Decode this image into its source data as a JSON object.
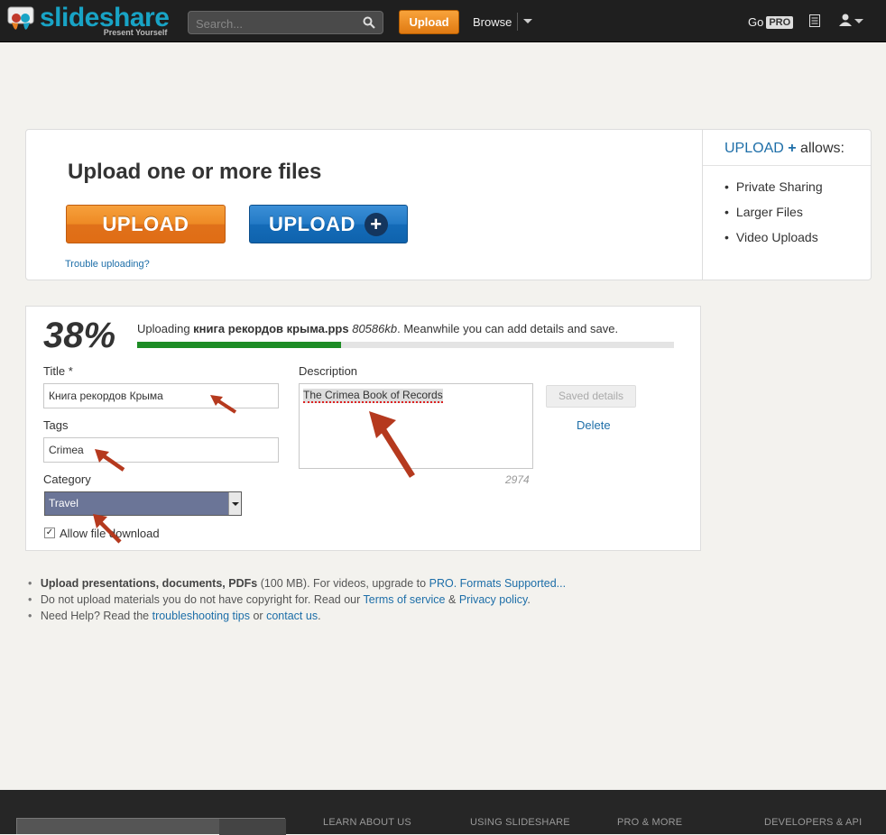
{
  "header": {
    "logo_word": "slideshare",
    "logo_tagline": "Present Yourself",
    "search_placeholder": "Search...",
    "upload_label": "Upload",
    "browse_label": "Browse",
    "go_label": "Go",
    "pro_badge": "PRO"
  },
  "upload_card": {
    "title": "Upload one or more files",
    "upload_button": "UPLOAD",
    "upload_plus_button": "UPLOAD",
    "plus_symbol": "+",
    "trouble_link": "Trouble uploading?",
    "allows_upload": "UPLOAD",
    "allows_plus": "+",
    "allows_suffix": "allows:",
    "allows_items": [
      "Private Sharing",
      "Larger Files",
      "Video Uploads"
    ]
  },
  "progress": {
    "percent_label": "38%",
    "percent_value": 0.38,
    "status_prefix": "Uploading",
    "file_name": "книга рекордов крыма.pps",
    "file_size": "80586kb",
    "status_suffix": ". Meanwhile you can add details and save."
  },
  "form": {
    "title_label": "Title *",
    "title_value": "Книга рекордов Крыма",
    "tags_label": "Tags",
    "tags_value": "Crimea",
    "category_label": "Category",
    "category_value": "Travel",
    "allow_download_label": "Allow file download",
    "description_label": "Description",
    "description_value": "The Crimea Book of Records",
    "char_count": "2974",
    "saved_button": "Saved details",
    "delete_link": "Delete"
  },
  "notes": {
    "line1_bold": "Upload presentations, documents, PDFs",
    "line1_text": "(100 MB). For videos, upgrade to",
    "line1_link1": "PRO.",
    "line1_link2": "Formats Supported...",
    "line2_text": "Do not upload materials you do not have copyright for. Read our",
    "line2_link1": "Terms of service",
    "line2_amp": "&",
    "line2_link2": "Privacy policy",
    "line2_end": ".",
    "line3_text": "Need Help? Read the",
    "line3_link1": "troubleshooting tips",
    "line3_or": "or",
    "line3_link2": "contact us",
    "line3_end": "."
  },
  "footer": {
    "col1": "LEARN ABOUT US",
    "col2": "USING SLIDESHARE",
    "col3": "PRO & MORE",
    "col4": "DEVELOPERS & API"
  },
  "colors": {
    "accent_blue": "#1d6ea8",
    "upload_orange": "#ee8a24",
    "progress_green": "#1d8c25",
    "annotation_arrow": "#b5391e"
  }
}
